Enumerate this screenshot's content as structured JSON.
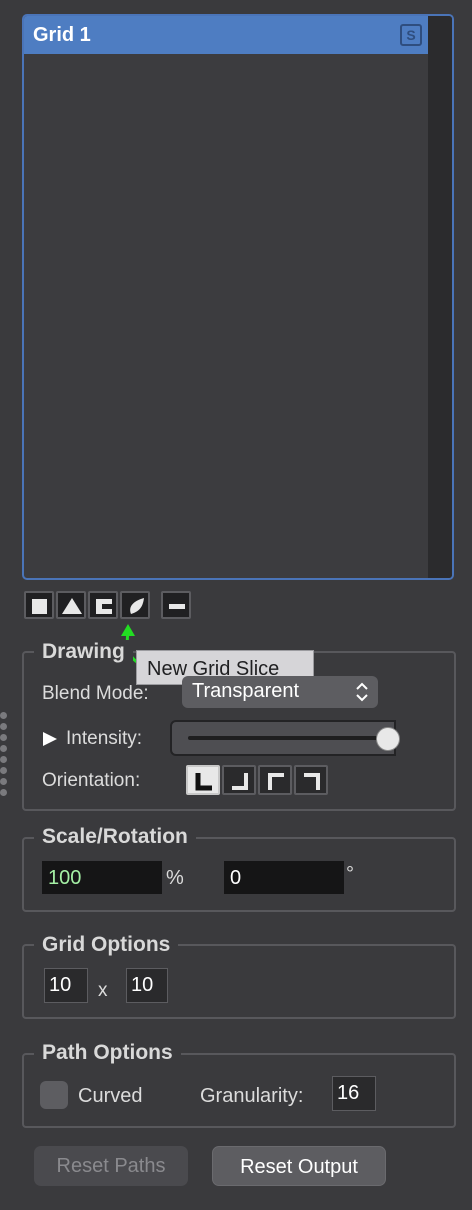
{
  "slices": {
    "items": [
      {
        "name": "Grid 1",
        "solo_badge": "S"
      }
    ]
  },
  "toolbar": {
    "buttons": [
      "new-rect-slice",
      "new-triangle-slice",
      "new-mask-slice",
      "new-grid-slice",
      "remove-slice"
    ],
    "tooltip": "New Grid Slice",
    "pointer_color": "#22dd22"
  },
  "drawing": {
    "title": "Drawing",
    "blend_mode_label": "Blend Mode:",
    "blend_mode_value": "Transparent",
    "intensity_label": "Intensity:",
    "intensity_value": 1.0,
    "orientation_label": "Orientation:",
    "orientation_selected": 0
  },
  "scale_rotation": {
    "title": "Scale/Rotation",
    "scale_value": "100",
    "scale_unit": "%",
    "rotation_value": "0",
    "rotation_unit": "°"
  },
  "grid_options": {
    "title": "Grid Options",
    "columns": "10",
    "separator": "x",
    "rows": "10"
  },
  "path_options": {
    "title": "Path Options",
    "curved_label": "Curved",
    "curved_checked": false,
    "granularity_label": "Granularity:",
    "granularity_value": "16"
  },
  "buttons": {
    "reset_paths": "Reset Paths",
    "reset_output": "Reset Output"
  },
  "colors": {
    "selection": "#4e7dc2",
    "list_border": "#4a74b8",
    "background": "#3a3a3d"
  }
}
